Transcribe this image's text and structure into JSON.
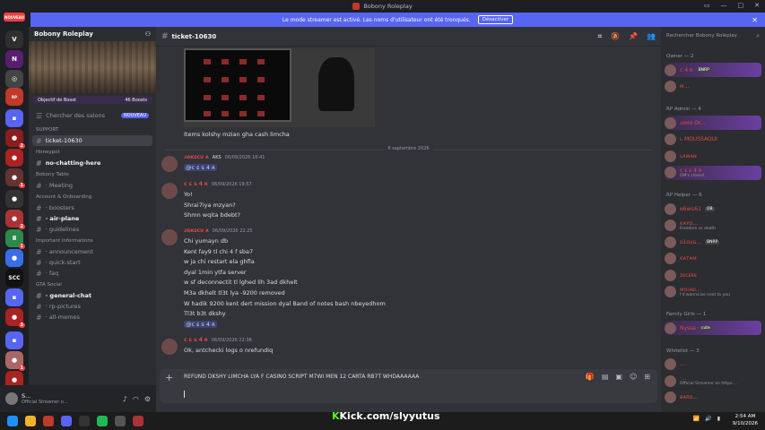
{
  "window": {
    "title": "Bobony Roleplay"
  },
  "banner": {
    "text": "Le mode streamer est activé. Les noms d'utilisateur ont été tronqués.",
    "button": "Désactiver"
  },
  "rail": {
    "new_badge": "NOUVEAU",
    "badges": [
      "2",
      "1",
      "2",
      "1",
      "3",
      "1",
      "3"
    ]
  },
  "server": {
    "name": "Bobony Roleplay",
    "boost_goal": "Objectif de Boost",
    "boost_count": "46 Boosts"
  },
  "sidebar": {
    "search": "Chercher des salons",
    "search_badge": "NOUVEAU",
    "items": [
      {
        "type": "cat",
        "label": "SUPPORT"
      },
      {
        "type": "chan",
        "label": "ticket-10630",
        "active": true
      },
      {
        "type": "cat",
        "label": "Honeypot"
      },
      {
        "type": "chan",
        "label": "no-chatting-here",
        "bold": true
      },
      {
        "type": "cat",
        "label": "Bobony Table"
      },
      {
        "type": "chan",
        "label": "· Meeting"
      },
      {
        "type": "cat",
        "label": "Account & Onboarding"
      },
      {
        "type": "chan",
        "label": "· boosters"
      },
      {
        "type": "chan",
        "label": "· air-plane",
        "bold": true
      },
      {
        "type": "chan",
        "label": "· guidelines"
      },
      {
        "type": "cat",
        "label": "Important Informations"
      },
      {
        "type": "chan",
        "label": "· announcement"
      },
      {
        "type": "chan",
        "label": "· quick-start"
      },
      {
        "type": "chan",
        "label": "· faq"
      },
      {
        "type": "cat",
        "label": "GTA Social"
      },
      {
        "type": "chan",
        "label": "· general-chat",
        "bold": true
      },
      {
        "type": "chan",
        "label": "· rp-pictures"
      },
      {
        "type": "chan",
        "label": "· all-memes"
      }
    ]
  },
  "user": {
    "name": "S...",
    "status": "Official Streamer o..."
  },
  "chat": {
    "channel": "ticket-10630",
    "first_line": "Items kolshy mzian gha cash limcha",
    "date_divider": "6 septembre 2026",
    "messages": [
      {
        "name": "ᴊᴏᴋᴇᴄᴜ ᴀ",
        "tags": "AKS",
        "time": "06/09/2026 16:41",
        "lines": [
          "@ᴄ ᴇ s 4 ʀ"
        ],
        "mention": [
          0
        ]
      },
      {
        "name": "ᴄ ᴇ s 4 ʀ",
        "time": "06/09/2026 19:57",
        "lines": [
          "Yo!",
          "Shrai7iya mzyan?",
          "Shmn wqita bdebt?"
        ]
      },
      {
        "name": "ᴊᴏᴋᴇᴄᴜ ᴀ",
        "time": "06/09/2026 22:25",
        "lines": [
          "Chi yumayn db",
          "Kent fay9 tl chi 4 f sba7",
          "w ja chi restart ela ghfla",
          "dyal 1min ytfa server",
          "w sf deconnectit tl lghed lih 3ad dkhelt",
          "M3a dkhelt tl3t lya -9200 removed",
          "W hadik 9200 kent dert mission dyal Band of notes bash nbeyedhom",
          "Tl3t b3t dkshy",
          "@ᴄ ᴇ s 4 ʀ"
        ],
        "mention": [
          8
        ]
      },
      {
        "name": "ᴄ ᴇ s 4 ʀ",
        "time": "06/09/2026 22:38",
        "lines": [
          "Ok, antchecki logs o nrefundiq"
        ]
      }
    ],
    "composer_text": "REFUND DKSHY LIMCHA LYA F CASINO SCRIPT M7WI MEN 12 CARTA RB7T WHDAAAAAA"
  },
  "members": {
    "search": "Rechercher Bobony Roleplay",
    "groups": [
      {
        "label": "Owner — 2",
        "members": [
          {
            "name": "ᴄ 4 ʀ",
            "sub": "",
            "tag": "BNRP",
            "hl": true
          },
          {
            "name": "ᴍ...",
            "sub": ""
          }
        ]
      },
      {
        "label": "RP Admin — 4",
        "members": [
          {
            "name": "ᴊᴏᴍᴏ Or...",
            "sub": "",
            "hl": true
          },
          {
            "name": "ʟ MOUSSAOUI",
            "sub": ""
          },
          {
            "name": "ʟᴀᴡᴀɴ",
            "sub": ""
          },
          {
            "name": "ᴄ ᴇ s 4 ʀ",
            "sub": "DM's closed.",
            "hl": true
          }
        ]
      },
      {
        "label": "RP Helper — 6",
        "members": [
          {
            "name": "ɴ6ᴡɢ61",
            "sub": "",
            "tag": "OB"
          },
          {
            "name": "ᴋᴀʏᴅ...",
            "sub": "Freedom or death"
          },
          {
            "name": "ᴅ1ᴏᴜɢ...",
            "sub": "",
            "tag": "BNRP"
          },
          {
            "name": "ᴋᴀᴛᴀᴍ",
            "sub": ""
          },
          {
            "name": "ᴢᴇᴄᴇʀᴇ",
            "sub": ""
          },
          {
            "name": "ᴍᴏᴊᴀᴅ...",
            "sub": "I'd wanna be next to you"
          }
        ]
      },
      {
        "label": "Family Girls — 1",
        "members": [
          {
            "name": "Nyssa",
            "sub": "",
            "tag": "cute",
            "hl": true
          }
        ]
      },
      {
        "label": "Whitelist — 3",
        "members": [
          {
            "name": "...",
            "sub": ""
          },
          {
            "name": "·...",
            "sub": "Official Streamer on https:..."
          },
          {
            "name": "ʙᴀʀᴅ...",
            "sub": ""
          }
        ]
      }
    ]
  },
  "stream": {
    "overlay": "Kick.com/slyyutus"
  },
  "clock": {
    "time": "2:54 AM",
    "date": "9/10/2026"
  }
}
